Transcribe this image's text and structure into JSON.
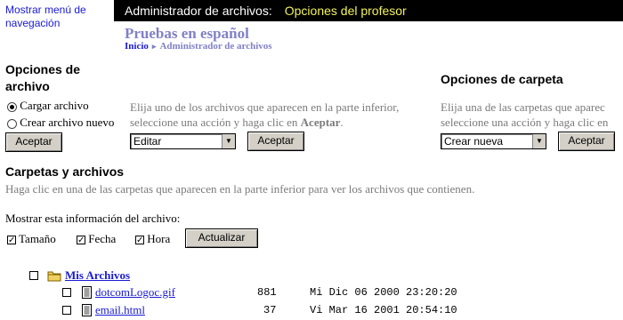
{
  "nav": {
    "toggle_label": "Mostrar menú de navegación"
  },
  "header": {
    "tool": "Administrador de archivos:",
    "section": "Opciones del profesor"
  },
  "course": {
    "title": "Pruebas en español",
    "breadcrumb": {
      "home": "Inicio",
      "current": "Administrador de archivos"
    }
  },
  "file_options": {
    "title": "Opciones de archivo",
    "radios": [
      {
        "label": "Cargar archivo",
        "checked": true
      },
      {
        "label": "Crear archivo nuevo",
        "checked": false
      }
    ],
    "accept_label": "Aceptar",
    "help_prefix": "Elija uno de los archivos que aparecen en la parte inferior, seleccione una acción y haga clic en ",
    "help_bold": "Aceptar",
    "help_suffix": ".",
    "action_select": "Editar",
    "action_accept": "Aceptar"
  },
  "folder_options": {
    "title": "Opciones de carpeta",
    "help_line1": "Elija una de las carpetas que aparec",
    "help_line2": "seleccione una acción y haga clic en",
    "select": "Crear nueva",
    "accept_label": "Aceptar"
  },
  "folders_files": {
    "title": "Carpetas y archivos",
    "help": "Haga clic en una de las carpetas que aparecen en la parte inferior para ver los archivos que contienen.",
    "show_info_label": "Mostrar esta información del archivo:",
    "show_options": [
      {
        "label": "Tamaño",
        "checked": true
      },
      {
        "label": "Fecha",
        "checked": true
      },
      {
        "label": "Hora",
        "checked": true
      }
    ],
    "update_label": "Actualizar",
    "root_folder": "Mis Archivos",
    "files": [
      {
        "name": "dotcomLogoc.gif",
        "size": "881",
        "date": "Mi Dic 06 2000 23:20:20"
      },
      {
        "name": "email.html",
        "size": "37",
        "date": "Vi Mar 16 2001 20:54:10"
      }
    ]
  }
}
